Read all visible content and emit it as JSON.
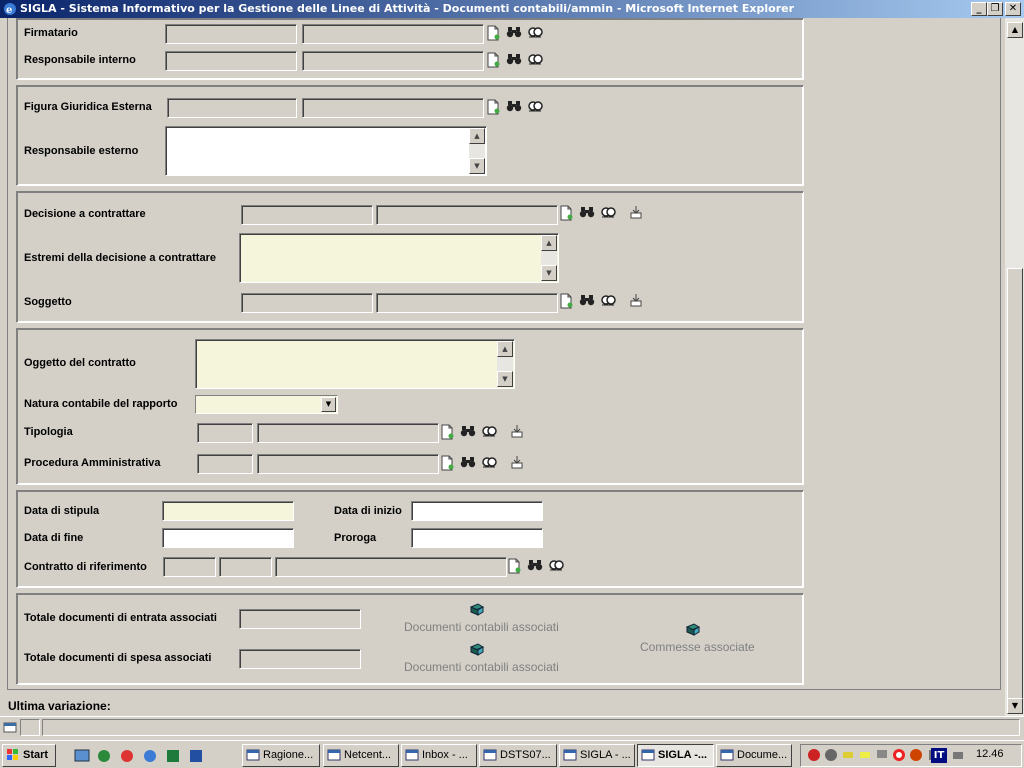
{
  "window": {
    "title": "SIGLA - Sistema Informativo per la Gestione delle Linee di Attività - Documenti contabili/ammin - Microsoft Internet Explorer"
  },
  "form": {
    "firmatario": "Firmatario",
    "responsabile_interno": "Responsabile interno",
    "figura_giuridica_esterna": "Figura Giuridica Esterna",
    "responsabile_esterno": "Responsabile esterno",
    "decisione_a_contrattare": "Decisione a contrattare",
    "estremi_decisione": "Estremi della decisione a contrattare",
    "soggetto": "Soggetto",
    "oggetto_contratto": "Oggetto del contratto",
    "natura_contabile": "Natura contabile del rapporto",
    "tipologia": "Tipologia",
    "procedura_amministrativa": "Procedura Amministrativa",
    "data_stipula": "Data di stipula",
    "data_inizio": "Data di inizio",
    "data_fine": "Data di fine",
    "proroga": "Proroga",
    "contratto_riferimento": "Contratto di riferimento",
    "totale_entrata": "Totale documenti di entrata associati",
    "totale_spesa": "Totale documenti di spesa associati",
    "doc_contabili_1": "Documenti contabili associati",
    "doc_contabili_2": "Documenti contabili associati",
    "commesse": "Commesse associate"
  },
  "status": {
    "ultima_variazione": "Ultima variazione:"
  },
  "taskbar": {
    "start": "Start",
    "items": [
      "Ragione...",
      "Netcent...",
      "Inbox - ...",
      "DSTS07...",
      "SIGLA - ...",
      "SIGLA -...",
      "Docume..."
    ],
    "clock": "12.46",
    "lang": "IT"
  },
  "icons": {
    "new": "new-doc-icon",
    "search": "binoculars-icon",
    "free_search": "free-search-icon",
    "detail": "detail-icon",
    "book": "book-icon"
  }
}
